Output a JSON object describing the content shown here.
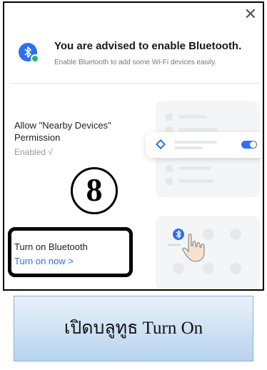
{
  "dialog": {
    "close_icon": "close-icon",
    "title": "You are advised to enable Bluetooth.",
    "subtitle": "Enable Bluetooth to add some Wi-Fi devices easily.",
    "permission": {
      "label": "Allow \"Nearby Devices\" Permission",
      "status": "Enabled √"
    },
    "bluetooth": {
      "label": "Turn on Bluetooth",
      "action": "Turn on now >",
      "illustration_label": "Bluetooth"
    }
  },
  "annotation": {
    "step_number": "8"
  },
  "banner": {
    "text": "เปิดบลูทูธ Turn On"
  },
  "colors": {
    "accent": "#2d6ff2",
    "success": "#22b573",
    "banner_top": "#e9f1fa",
    "banner_bottom": "#b8d3ee"
  }
}
